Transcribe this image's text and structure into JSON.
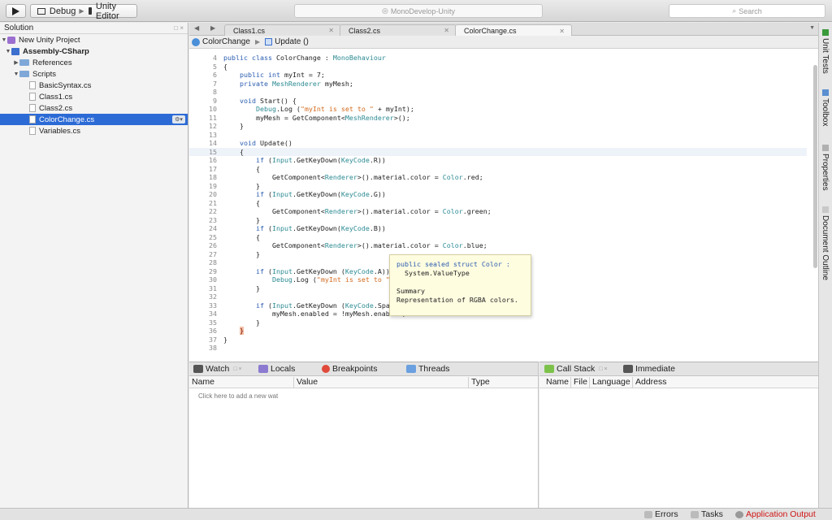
{
  "toolbar": {
    "config_label": "Debug",
    "target_label": "Unity Editor",
    "status_text": "MonoDevelop-Unity",
    "search_placeholder": "Search"
  },
  "solution": {
    "title": "Solution",
    "pin_controls": "□ ×",
    "items": [
      {
        "label": "New Unity Project"
      },
      {
        "label": "Assembly-CSharp"
      },
      {
        "label": "References"
      },
      {
        "label": "Scripts"
      },
      {
        "label": "BasicSyntax.cs"
      },
      {
        "label": "Class1.cs"
      },
      {
        "label": "Class2.cs"
      },
      {
        "label": "ColorChange.cs"
      },
      {
        "label": "Variables.cs"
      }
    ]
  },
  "tabs": [
    {
      "label": "Class1.cs"
    },
    {
      "label": "Class2.cs"
    },
    {
      "label": "ColorChange.cs"
    }
  ],
  "breadcrumb": {
    "class": "ColorChange",
    "method": "Update ()"
  },
  "editor": {
    "lines": [
      {
        "n": "4",
        "text": "public class ColorChange : MonoBehaviour"
      },
      {
        "n": "5",
        "text": "{"
      },
      {
        "n": "6",
        "text": "    public int myInt = 7;"
      },
      {
        "n": "7",
        "text": "    private MeshRenderer myMesh;"
      },
      {
        "n": "8",
        "text": ""
      },
      {
        "n": "9",
        "text": "    void Start() {"
      },
      {
        "n": "10",
        "text": "        Debug.Log (\"myInt is set to \" + myInt);"
      },
      {
        "n": "11",
        "text": "        myMesh = GetComponent<MeshRenderer>();"
      },
      {
        "n": "12",
        "text": "    }"
      },
      {
        "n": "13",
        "text": ""
      },
      {
        "n": "14",
        "text": "    void Update()"
      },
      {
        "n": "15",
        "text": "    {"
      },
      {
        "n": "16",
        "text": "        if (Input.GetKeyDown(KeyCode.R))"
      },
      {
        "n": "17",
        "text": "        {"
      },
      {
        "n": "18",
        "text": "            GetComponent<Renderer>().material.color = Color.red;"
      },
      {
        "n": "19",
        "text": "        }"
      },
      {
        "n": "20",
        "text": "        if (Input.GetKeyDown(KeyCode.G))"
      },
      {
        "n": "21",
        "text": "        {"
      },
      {
        "n": "22",
        "text": "            GetComponent<Renderer>().material.color = Color.green;"
      },
      {
        "n": "23",
        "text": "        }"
      },
      {
        "n": "24",
        "text": "        if (Input.GetKeyDown(KeyCode.B))"
      },
      {
        "n": "25",
        "text": "        {"
      },
      {
        "n": "26",
        "text": "            GetComponent<Renderer>().material.color = Color.blue;"
      },
      {
        "n": "27",
        "text": "        }"
      },
      {
        "n": "28",
        "text": ""
      },
      {
        "n": "29",
        "text": "        if (Input.GetKeyDown (KeyCode.A))"
      },
      {
        "n": "30",
        "text": "            Debug.Log (\"myInt is set to \" + myInt);"
      },
      {
        "n": "31",
        "text": "        }"
      },
      {
        "n": "32",
        "text": ""
      },
      {
        "n": "33",
        "text": "        if (Input.GetKeyDown (KeyCode.Space)) {"
      },
      {
        "n": "34",
        "text": "            myMesh.enabled = !myMesh.enabled;"
      },
      {
        "n": "35",
        "text": "        }"
      },
      {
        "n": "36",
        "text": "    }"
      },
      {
        "n": "37",
        "text": "}"
      },
      {
        "n": "38",
        "text": ""
      }
    ],
    "current_line": "15"
  },
  "tooltip": {
    "signature": "public sealed struct Color :",
    "base_type": "  System.ValueType",
    "summary_label": "Summary",
    "summary_text": "Representation of RGBA colors."
  },
  "right_dock": [
    {
      "label": "Unit Tests"
    },
    {
      "label": "Toolbox"
    },
    {
      "label": "Properties"
    },
    {
      "label": "Document Outline"
    }
  ],
  "watch_pad": {
    "tabs": [
      {
        "label": "Watch"
      },
      {
        "label": "Locals"
      },
      {
        "label": "Breakpoints"
      },
      {
        "label": "Threads"
      }
    ],
    "pin_controls": "□ ×",
    "columns": [
      "Name",
      "Value",
      "Type"
    ],
    "add_hint": "Click here to add a new wat"
  },
  "callstack_pad": {
    "tabs": [
      {
        "label": "Call Stack"
      },
      {
        "label": "Immediate"
      }
    ],
    "pin_controls": "□ ×",
    "columns": [
      "Name",
      "File",
      "Language",
      "Address"
    ]
  },
  "statusbar": {
    "errors": "Errors",
    "tasks": "Tasks",
    "app_output": "Application Output"
  },
  "colors": {
    "selection": "#2c6bd6",
    "keyword": "#2a5db0",
    "type": "#2b8a92",
    "string": "#d2691e",
    "app_output_text": "#d01515"
  }
}
